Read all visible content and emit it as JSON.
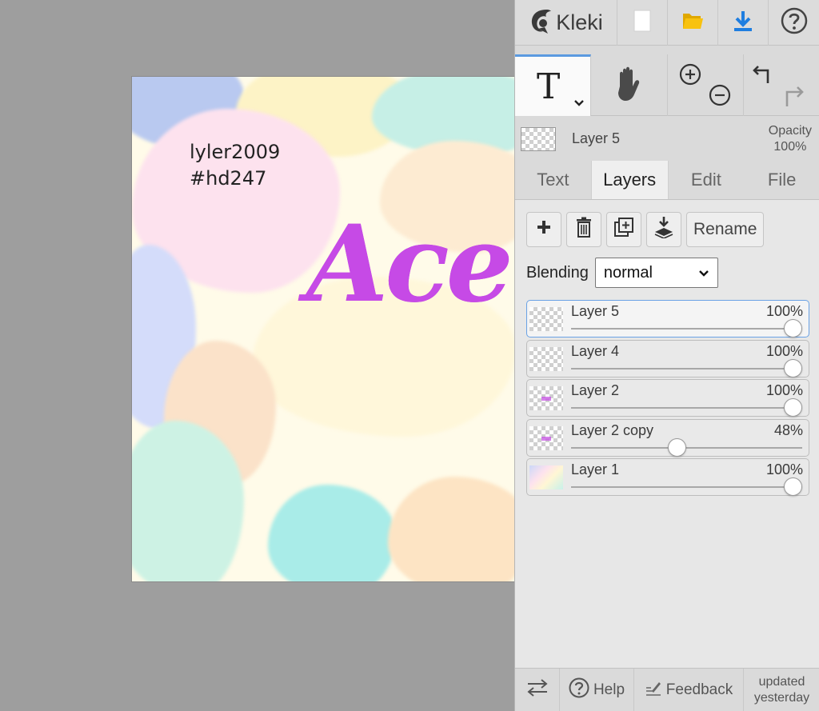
{
  "app": {
    "name": "Kleki"
  },
  "canvas": {
    "text_lines": [
      "lyler2009",
      "#hd247"
    ],
    "art_text": "Ace",
    "art_color": "#c64ae6"
  },
  "topbar": {
    "icons": [
      "kleki-logo-icon",
      "new-file-icon",
      "open-folder-icon",
      "download-icon",
      "help-circle-icon"
    ]
  },
  "tools": {
    "text_tool_glyph": "T",
    "icons": [
      "caret-down-icon",
      "hand-icon",
      "zoom-in-icon",
      "zoom-out-icon",
      "undo-icon",
      "redo-icon"
    ]
  },
  "current_layer": {
    "name": "Layer 5",
    "opacity_label": "Opacity",
    "opacity_value": "100%"
  },
  "tabs": [
    {
      "label": "Text",
      "active": false
    },
    {
      "label": "Layers",
      "active": true
    },
    {
      "label": "Edit",
      "active": false
    },
    {
      "label": "File",
      "active": false
    }
  ],
  "layer_controls": {
    "rename_label": "Rename",
    "blending_label": "Blending",
    "blending_value": "normal"
  },
  "layers": [
    {
      "name": "Layer 5",
      "opacity": "100%",
      "level": 1.0,
      "selected": true
    },
    {
      "name": "Layer 4",
      "opacity": "100%",
      "level": 1.0,
      "selected": false
    },
    {
      "name": "Layer 2",
      "opacity": "100%",
      "level": 1.0,
      "selected": false
    },
    {
      "name": "Layer 2 copy",
      "opacity": "48%",
      "level": 0.48,
      "selected": false
    },
    {
      "name": "Layer 1",
      "opacity": "100%",
      "level": 1.0,
      "selected": false
    }
  ],
  "footer": {
    "help_label": "Help",
    "feedback_label": "Feedback",
    "updated_line1": "updated",
    "updated_line2": "yesterday"
  },
  "colors": {
    "accent_blue": "#1f7ee0",
    "folder_yellow": "#f5b800",
    "selected_border": "#6aa2e5"
  }
}
